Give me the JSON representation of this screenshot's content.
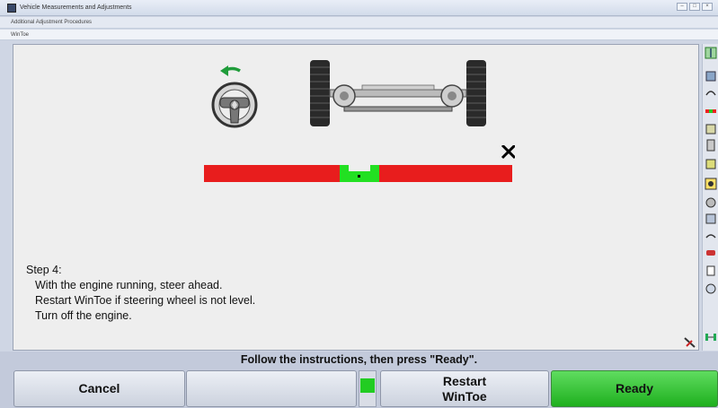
{
  "window": {
    "title": "Vehicle Measurements and Adjustments"
  },
  "breadcrumb": "Additional Adjustment Procedures",
  "subtitle": "WinToe",
  "instructions": {
    "step": "Step 4:",
    "lines": [
      "With the engine running, steer ahead.",
      "Restart WinToe if steering wheel is not level.",
      "Turn off the engine."
    ]
  },
  "status_text": "Follow the instructions, then press \"Ready\".",
  "buttons": {
    "cancel": "Cancel",
    "restart_line1": "Restart",
    "restart_line2": "WinToe",
    "ready": "Ready"
  },
  "colors": {
    "bar_red": "#e81d1d",
    "bar_green": "#22e022",
    "ready_green": "#2cc42c",
    "arrow_green": "#1f9c3a"
  },
  "icons": {
    "steering": "steering-wheel-icon",
    "axle": "front-axle-icon",
    "status": "x-mark-icon",
    "arrow": "turn-left-arrow-icon"
  }
}
